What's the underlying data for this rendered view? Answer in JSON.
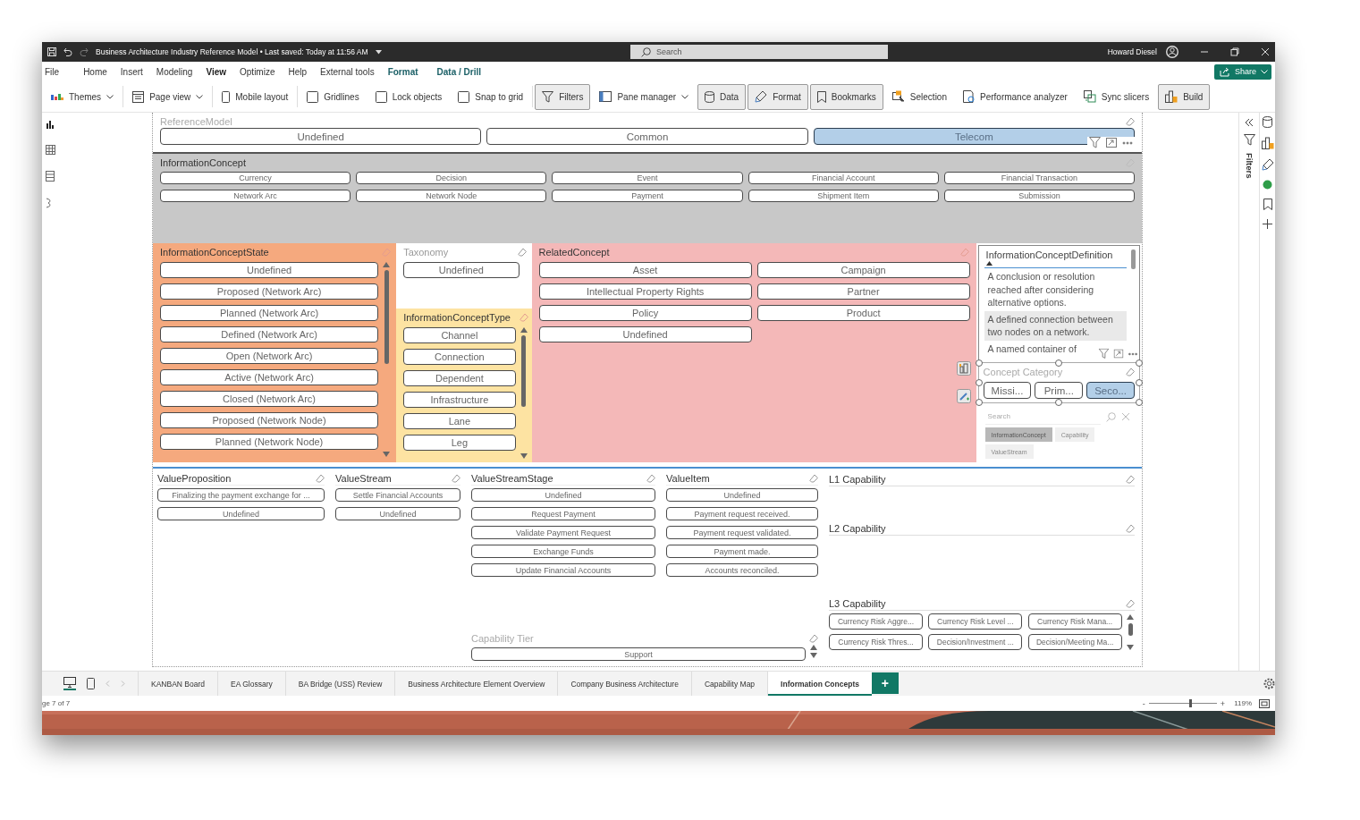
{
  "window": {
    "title": "Business Architecture Industry Reference Model • Last saved: Today at 11:56 AM",
    "search_placeholder": "Search",
    "user": "Howard Diesel"
  },
  "menu": [
    {
      "label": "File",
      "selected": false,
      "kind": "tab"
    },
    {
      "label": "Home",
      "selected": false,
      "kind": "tab"
    },
    {
      "label": "Insert",
      "selected": false,
      "kind": "tab"
    },
    {
      "label": "Modeling",
      "selected": false,
      "kind": "tab"
    },
    {
      "label": "View",
      "selected": true,
      "kind": "tab"
    },
    {
      "label": "Optimize",
      "selected": false,
      "kind": "tab"
    },
    {
      "label": "Help",
      "selected": false,
      "kind": "tab"
    },
    {
      "label": "External tools",
      "selected": false,
      "kind": "tab"
    },
    {
      "label": "Format",
      "selected": false,
      "kind": "contextual"
    },
    {
      "label": "Data / Drill",
      "selected": false,
      "kind": "contextual"
    }
  ],
  "share": "Share",
  "ribbon": [
    {
      "label": "Themes",
      "kind": "dropdown"
    },
    {
      "label": "Page view",
      "kind": "dropdown"
    },
    {
      "label": "Mobile layout",
      "kind": "button"
    },
    {
      "label": "Gridlines",
      "kind": "checkbox",
      "checked": false
    },
    {
      "label": "Lock objects",
      "kind": "checkbox",
      "checked": false
    },
    {
      "label": "Snap to grid",
      "kind": "checkbox",
      "checked": false
    },
    {
      "label": "Filters",
      "kind": "toggle",
      "pressed": true
    },
    {
      "label": "Pane manager",
      "kind": "dropdown"
    },
    {
      "label": "Data",
      "kind": "toggle",
      "pressed": true
    },
    {
      "label": "Format",
      "kind": "toggle",
      "pressed": true
    },
    {
      "label": "Bookmarks",
      "kind": "toggle",
      "pressed": true
    },
    {
      "label": "Selection",
      "kind": "toggle",
      "pressed": false
    },
    {
      "label": "Performance analyzer",
      "kind": "toggle",
      "pressed": false
    },
    {
      "label": "Sync slicers",
      "kind": "toggle",
      "pressed": false
    },
    {
      "label": "Build",
      "kind": "toggle",
      "pressed": true
    }
  ],
  "filters_pane": {
    "label": "Filters"
  },
  "reference_model": {
    "title": "ReferenceModel",
    "items": [
      {
        "label": "Undefined",
        "selected": false
      },
      {
        "label": "Common",
        "selected": false
      },
      {
        "label": "Telecom",
        "selected": true
      }
    ]
  },
  "information_concept": {
    "title": "InformationConcept",
    "items": [
      {
        "label": "Currency",
        "selected": false
      },
      {
        "label": "Decision",
        "selected": false
      },
      {
        "label": "Event",
        "selected": false
      },
      {
        "label": "Financial Account",
        "selected": false
      },
      {
        "label": "Financial Transaction",
        "selected": false
      },
      {
        "label": "Network Arc",
        "selected": false
      },
      {
        "label": "Network Node",
        "selected": false
      },
      {
        "label": "Payment",
        "selected": false
      },
      {
        "label": "Shipment Item",
        "selected": false
      },
      {
        "label": "Submission",
        "selected": false
      }
    ]
  },
  "information_concept_state": {
    "title": "InformationConceptState",
    "items": [
      {
        "label": "Undefined",
        "selected": false
      },
      {
        "label": "Proposed (Network Arc)",
        "selected": false
      },
      {
        "label": "Planned (Network Arc)",
        "selected": false
      },
      {
        "label": "Defined (Network Arc)",
        "selected": false
      },
      {
        "label": "Open (Network Arc)",
        "selected": false
      },
      {
        "label": "Active (Network Arc)",
        "selected": false
      },
      {
        "label": "Closed (Network Arc)",
        "selected": false
      },
      {
        "label": "Proposed (Network Node)",
        "selected": false
      },
      {
        "label": "Planned (Network Node)",
        "selected": false
      }
    ]
  },
  "taxonomy": {
    "title": "Taxonomy",
    "items": [
      {
        "label": "Undefined",
        "selected": false
      }
    ]
  },
  "information_concept_type": {
    "title": "InformationConceptType",
    "items": [
      {
        "label": "Channel",
        "selected": false
      },
      {
        "label": "Connection",
        "selected": false
      },
      {
        "label": "Dependent",
        "selected": false
      },
      {
        "label": "Infrastructure",
        "selected": false
      },
      {
        "label": "Lane",
        "selected": false
      },
      {
        "label": "Leg",
        "selected": false
      }
    ]
  },
  "related_concept": {
    "title": "RelatedConcept",
    "items": [
      {
        "label": "Asset",
        "selected": false
      },
      {
        "label": "Campaign",
        "selected": false
      },
      {
        "label": "Intellectual Property Rights",
        "selected": false
      },
      {
        "label": "Partner",
        "selected": false
      },
      {
        "label": "Policy",
        "selected": false
      },
      {
        "label": "Product",
        "selected": false
      },
      {
        "label": "Undefined",
        "selected": false
      }
    ]
  },
  "definition": {
    "column": "InformationConceptDefinition",
    "rows": [
      {
        "text": "A conclusion or resolution reached after considering alternative options.",
        "selected": false
      },
      {
        "text": "A defined connection between two nodes on a network.",
        "selected": true
      },
      {
        "text": "A named container of",
        "selected": false
      }
    ]
  },
  "concept_category": {
    "title": "Concept Category",
    "items": [
      {
        "label": "Missi...",
        "selected": false
      },
      {
        "label": "Prim...",
        "selected": false
      },
      {
        "label": "Seco...",
        "selected": true
      }
    ]
  },
  "field_search": {
    "placeholder": "Search",
    "chips": [
      {
        "label": "InformationConcept",
        "selected": true
      },
      {
        "label": "Capability",
        "selected": false
      },
      {
        "label": "ValueStream",
        "selected": false
      }
    ]
  },
  "value_proposition": {
    "title": "ValueProposition",
    "items": [
      {
        "label": "Finalizing the payment exchange for ...",
        "selected": false
      },
      {
        "label": "Undefined",
        "selected": false
      }
    ]
  },
  "value_stream": {
    "title": "ValueStream",
    "items": [
      {
        "label": "Settle Financial Accounts",
        "selected": false
      },
      {
        "label": "Undefined",
        "selected": false
      }
    ]
  },
  "value_stream_stage": {
    "title": "ValueStreamStage",
    "items": [
      {
        "label": "Undefined",
        "selected": false
      },
      {
        "label": "Request Payment",
        "selected": false
      },
      {
        "label": "Validate Payment Request",
        "selected": false
      },
      {
        "label": "Exchange Funds",
        "selected": false
      },
      {
        "label": "Update Financial Accounts",
        "selected": false
      }
    ]
  },
  "value_item": {
    "title": "ValueItem",
    "items": [
      {
        "label": "Undefined",
        "selected": false
      },
      {
        "label": "Payment request received.",
        "selected": false
      },
      {
        "label": "Payment request validated.",
        "selected": false
      },
      {
        "label": "Payment made.",
        "selected": false
      },
      {
        "label": "Accounts reconciled.",
        "selected": false
      }
    ]
  },
  "capability_tier": {
    "title": "Capability Tier",
    "items": [
      {
        "label": "Support",
        "selected": false
      }
    ]
  },
  "l1_capability": {
    "title": "L1 Capability"
  },
  "l2_capability": {
    "title": "L2 Capability"
  },
  "l3_capability": {
    "title": "L3 Capability",
    "items": [
      {
        "label": "Currency Risk Aggre...",
        "selected": false
      },
      {
        "label": "Currency Risk Level ...",
        "selected": false
      },
      {
        "label": "Currency Risk Mana...",
        "selected": false
      },
      {
        "label": "Currency Risk Thres...",
        "selected": false
      },
      {
        "label": "Decision/Investment ...",
        "selected": false
      },
      {
        "label": "Decision/Meeting Ma...",
        "selected": false
      }
    ]
  },
  "pages": [
    {
      "label": "KANBAN Board",
      "selected": false
    },
    {
      "label": "EA Glossary",
      "selected": false
    },
    {
      "label": "BA Bridge (USS) Review",
      "selected": false
    },
    {
      "label": "Business Architecture Element Overview",
      "selected": false
    },
    {
      "label": "Company Business Architecture",
      "selected": false
    },
    {
      "label": "Capability Map",
      "selected": false
    },
    {
      "label": "Information Concepts",
      "selected": true
    }
  ],
  "add_page": "+",
  "status": {
    "page": "ge 7 of 7",
    "zoom_out": "-",
    "zoom_in": "+",
    "zoom": "119%"
  },
  "zoom_slider": {
    "level": 0.6
  }
}
